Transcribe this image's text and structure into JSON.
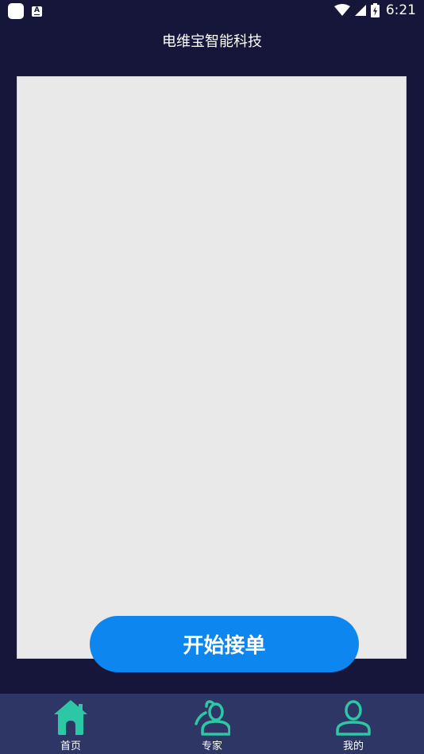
{
  "status_bar": {
    "time": "6:21",
    "notification_letter": "A"
  },
  "header": {
    "title": "电维宝智能科技"
  },
  "main": {
    "start_button_label": "开始接单"
  },
  "bottom_nav": {
    "items": [
      {
        "label": "首页",
        "icon": "home-icon"
      },
      {
        "label": "专家",
        "icon": "experts-icon"
      },
      {
        "label": "我的",
        "icon": "profile-icon"
      }
    ]
  },
  "colors": {
    "background": "#16163a",
    "panel": "#e9e9ea",
    "accent_button": "#0e86ef",
    "nav_background": "#2e3665",
    "nav_icon": "#2cc7a5"
  }
}
